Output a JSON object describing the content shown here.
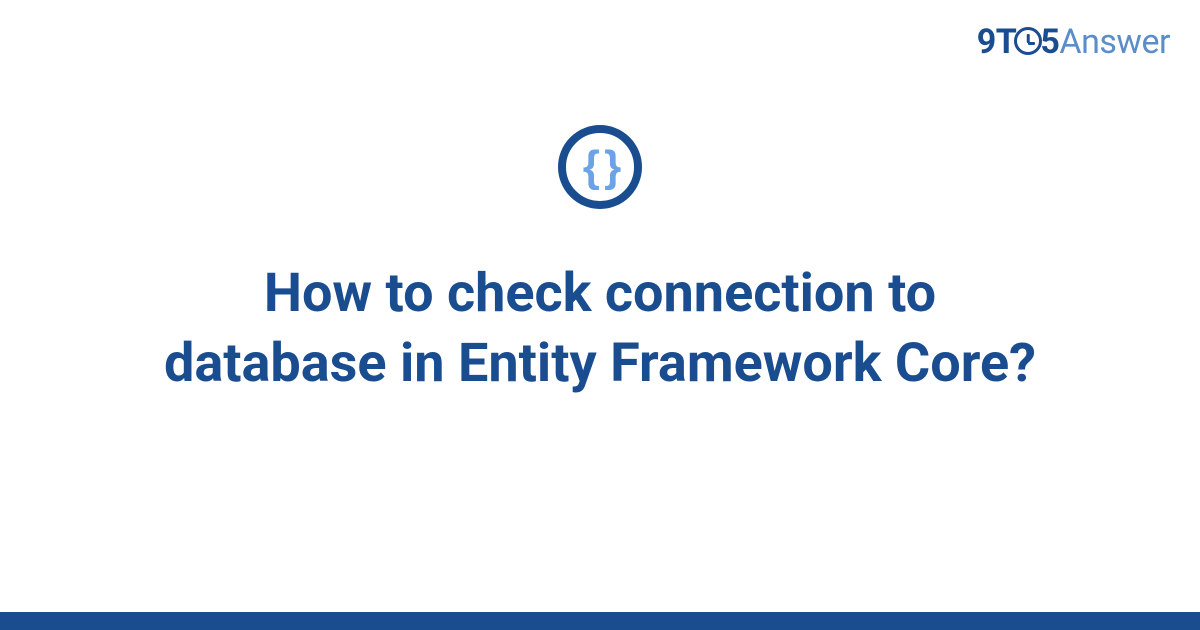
{
  "logo": {
    "part1": "9T",
    "part2": "5",
    "part3": "Answer"
  },
  "icon": {
    "name": "code-braces-icon",
    "glyph": "{ }"
  },
  "title": "How to check connection to database in Entity Framework Core?",
  "colors": {
    "primary": "#1a4d8f",
    "accent": "#6ba3e6",
    "logo_light": "#5a8dc9"
  }
}
